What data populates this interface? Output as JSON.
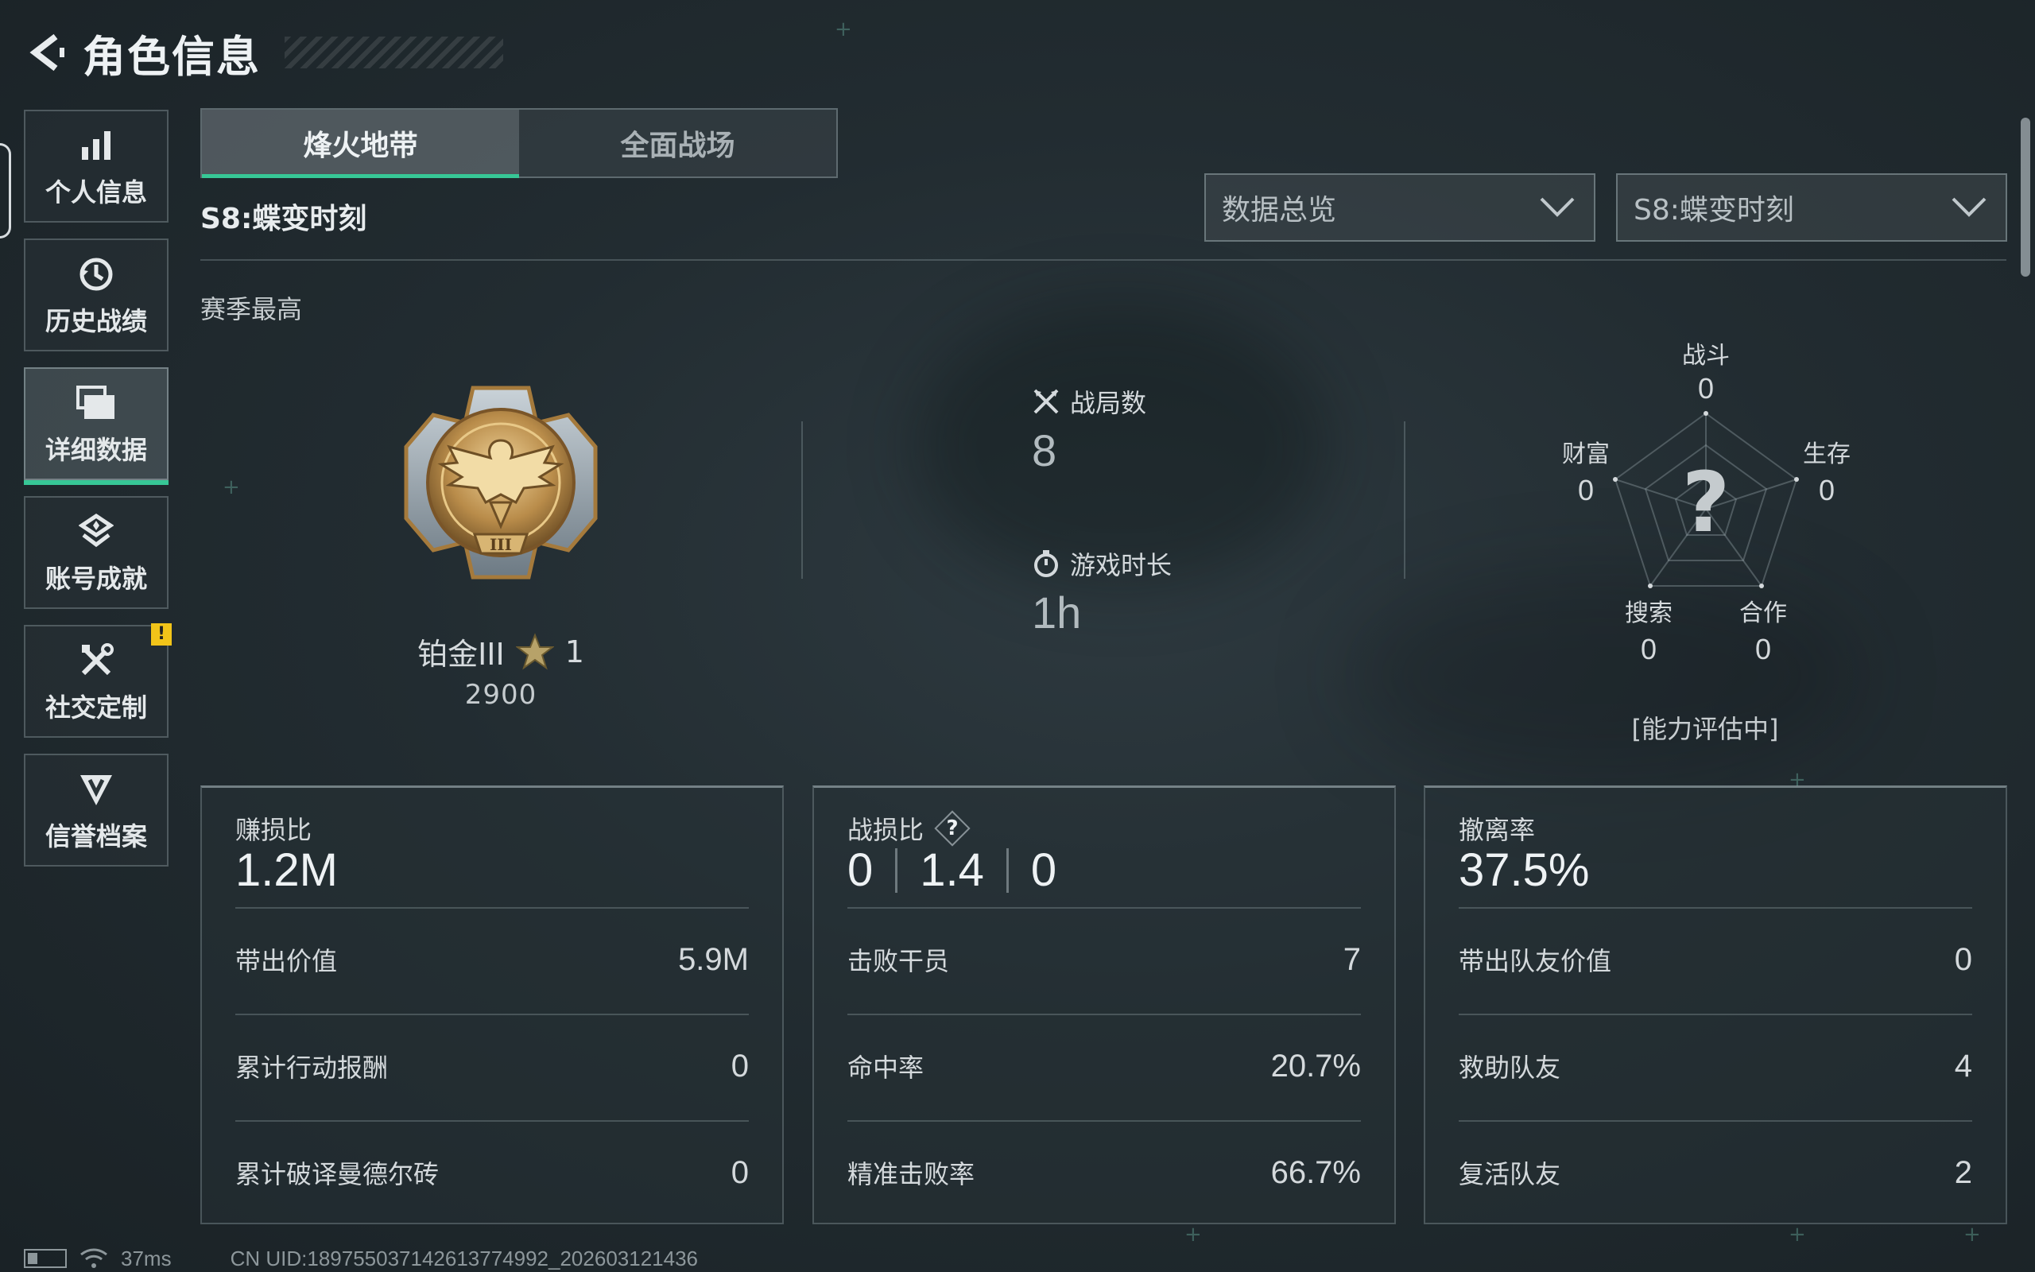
{
  "header": {
    "title": "角色信息"
  },
  "sidebar": {
    "items": [
      {
        "label": "个人信息",
        "icon": "bar-chart-icon",
        "active": false
      },
      {
        "label": "历史战绩",
        "icon": "history-clock-icon",
        "active": false
      },
      {
        "label": "详细数据",
        "icon": "folder-data-icon",
        "active": true
      },
      {
        "label": "账号成就",
        "icon": "achievement-icon",
        "active": false
      },
      {
        "label": "社交定制",
        "icon": "wrench-tools-icon",
        "active": false,
        "badge": "!"
      },
      {
        "label": "信誉档案",
        "icon": "credit-badge-icon",
        "active": false
      }
    ]
  },
  "tabs": [
    {
      "label": "烽火地带",
      "active": true
    },
    {
      "label": "全面战场",
      "active": false
    }
  ],
  "season_title": "S8:蝶变时刻",
  "filters": {
    "view": "数据总览",
    "season": "S8:蝶变时刻"
  },
  "season_best": {
    "label": "赛季最高",
    "rank_name": "铂金III",
    "stars": "1",
    "score": "2900"
  },
  "summary": {
    "matches_label": "战局数",
    "matches_value": "8",
    "playtime_label": "游戏时长",
    "playtime_value": "1h"
  },
  "radar": {
    "center": "?",
    "status": "[能力评估中]",
    "axes": [
      {
        "label": "战斗",
        "value": "0"
      },
      {
        "label": "生存",
        "value": "0"
      },
      {
        "label": "合作",
        "value": "0"
      },
      {
        "label": "搜索",
        "value": "0"
      },
      {
        "label": "财富",
        "value": "0"
      }
    ]
  },
  "cards": [
    {
      "title": "赚损比",
      "big": "1.2M",
      "rows": [
        {
          "label": "带出价值",
          "value": "5.9M"
        },
        {
          "label": "累计行动报酬",
          "value": "0"
        },
        {
          "label": "累计破译曼德尔砖",
          "value": "0"
        }
      ]
    },
    {
      "title": "战损比",
      "help": "?",
      "ratio": [
        "0",
        "1.4",
        "0"
      ],
      "rows": [
        {
          "label": "击败干员",
          "value": "7"
        },
        {
          "label": "命中率",
          "value": "20.7%"
        },
        {
          "label": "精准击败率",
          "value": "66.7%"
        }
      ]
    },
    {
      "title": "撤离率",
      "big": "37.5%",
      "rows": [
        {
          "label": "带出队友价值",
          "value": "0"
        },
        {
          "label": "救助队友",
          "value": "4"
        },
        {
          "label": "复活队友",
          "value": "2"
        }
      ]
    }
  ],
  "footer": {
    "ping": "37ms",
    "uid": "CN UID:18975503714261377499​2_202603121436"
  },
  "colors": {
    "accent": "#37c796",
    "warn": "#f2c419",
    "bg": "#222c31"
  }
}
